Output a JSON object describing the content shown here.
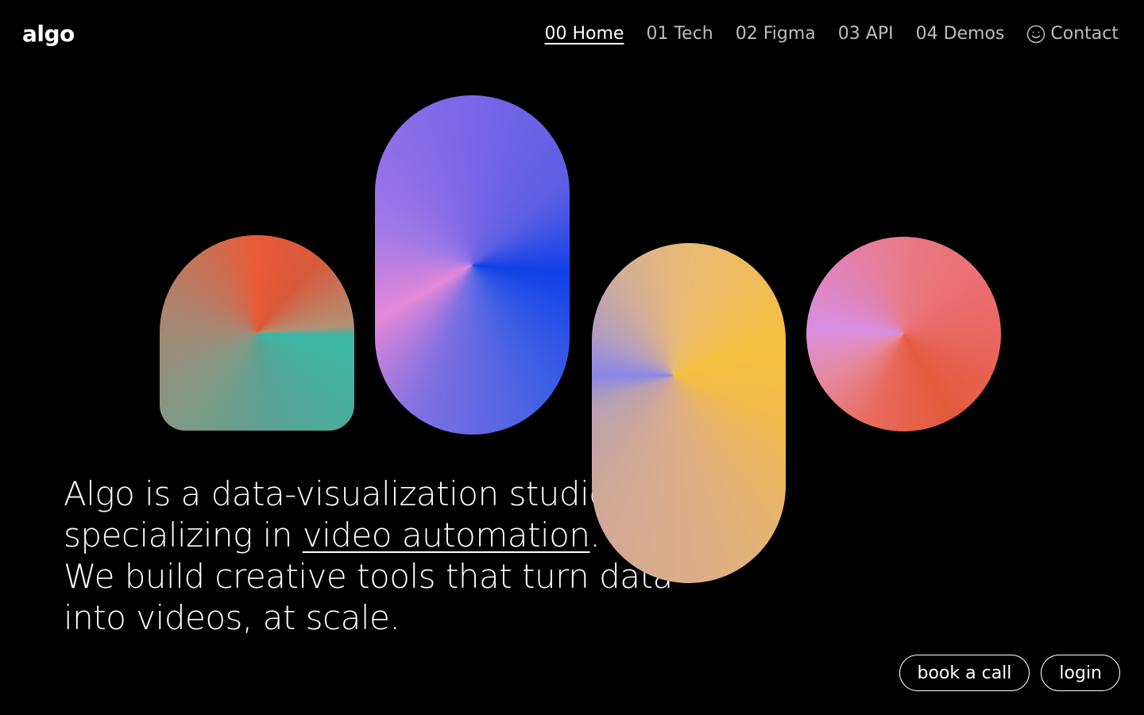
{
  "logo": {
    "text": "algo"
  },
  "nav": {
    "items": [
      {
        "label": "00 Home",
        "active": true
      },
      {
        "label": "01 Tech",
        "active": false
      },
      {
        "label": "02 Figma",
        "active": false
      },
      {
        "label": "03 API",
        "active": false
      },
      {
        "label": "04 Demos",
        "active": false
      }
    ],
    "contact": {
      "label": "Contact",
      "icon": "smiley-icon"
    }
  },
  "hero": {
    "line1": "Algo is a data-visualization studio",
    "line2_before": "specializing in ",
    "line2_link": "video automation",
    "line2_after": ".",
    "line3": "We build creative tools that turn data",
    "line4": "into videos, at scale."
  },
  "actions": {
    "book_call": "book a call",
    "login": "login"
  },
  "colors": {
    "background": "#000000",
    "text": "#ffffff",
    "nav_inactive": "#bdbdbd"
  }
}
